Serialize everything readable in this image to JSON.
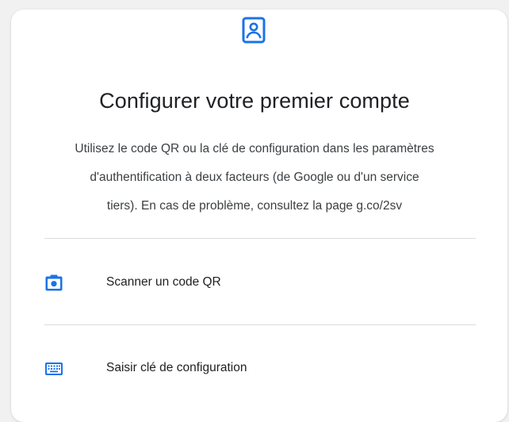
{
  "header": {
    "icon": "account-box-icon",
    "title": "Configurer votre premier compte"
  },
  "description": {
    "line1": "Utilisez le code QR ou la clé de configuration dans les paramètres",
    "line2": "d'authentification à deux facteurs (de Google ou d'un service",
    "line3": "tiers). En cas de problème, consultez la page g.co/2sv"
  },
  "options": [
    {
      "icon": "camera-icon",
      "label": "Scanner un code QR"
    },
    {
      "icon": "keyboard-icon",
      "label": "Saisir clé de configuration"
    }
  ],
  "colors": {
    "accent": "#1a73e8",
    "text": "#202124",
    "secondary_text": "#3c4043",
    "divider": "#dadce0"
  }
}
